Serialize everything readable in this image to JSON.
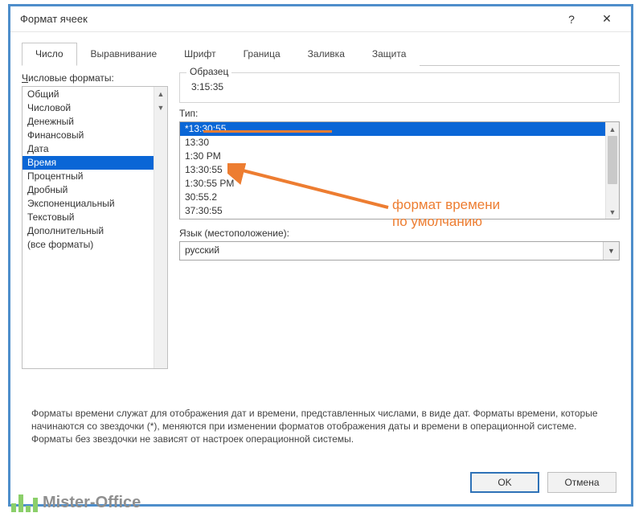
{
  "dialog": {
    "title": "Формат ячеек",
    "help_symbol": "?",
    "close_symbol": "✕"
  },
  "tabs": [
    "Число",
    "Выравнивание",
    "Шрифт",
    "Граница",
    "Заливка",
    "Защита"
  ],
  "left": {
    "label_html": "Числовые форматы:",
    "categories": [
      "Общий",
      "Числовой",
      "Денежный",
      "Финансовый",
      "Дата",
      "Время",
      "Процентный",
      "Дробный",
      "Экспоненциальный",
      "Текстовый",
      "Дополнительный",
      "(все форматы)"
    ],
    "selected_index": 5
  },
  "right": {
    "sample_legend": "Образец",
    "sample_value": "3:15:35",
    "type_label": "Тип:",
    "types": [
      "*13:30:55",
      "13:30",
      "1:30 PM",
      "13:30:55",
      "1:30:55 PM",
      "30:55.2",
      "37:30:55"
    ],
    "selected_type_index": 0,
    "lang_label": "Язык (местоположение):",
    "lang_value": "русский"
  },
  "description": "Форматы времени служат для отображения дат и времени, представленных числами, в виде дат. Форматы времени, которые начинаются со звездочки (*), меняются при изменении форматов отображения даты и времени в операционной системе. Форматы без звездочки не зависят от настроек операционной системы.",
  "buttons": {
    "ok": "OK",
    "cancel": "Отмена"
  },
  "annotation": {
    "line1": "формат времени",
    "line2": "по умолчанию"
  },
  "watermark": {
    "text": "Mister-Office"
  }
}
